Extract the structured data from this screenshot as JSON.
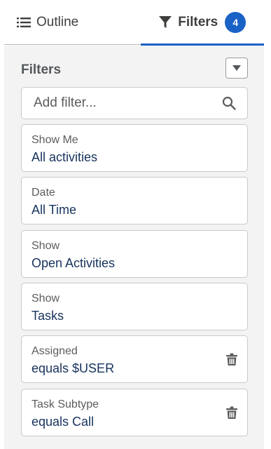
{
  "tabs": {
    "outline_label": "Outline",
    "filters_label": "Filters",
    "filters_count": "4"
  },
  "panel": {
    "title": "Filters",
    "search_placeholder": "Add filter..."
  },
  "filters": [
    {
      "label": "Show Me",
      "value": "All activities",
      "removable": false
    },
    {
      "label": "Date",
      "value": "All Time",
      "removable": false
    },
    {
      "label": "Show",
      "value": "Open Activities",
      "removable": false
    },
    {
      "label": "Show",
      "value": "Tasks",
      "removable": false
    },
    {
      "label": "Assigned",
      "value": "equals $USER",
      "removable": true
    },
    {
      "label": "Task Subtype",
      "value": "equals Call",
      "removable": true
    }
  ],
  "colors": {
    "accent": "#1b62c6",
    "value_text": "#16325c",
    "panel_bg": "#f3f3f3"
  },
  "icons": {
    "outline": "list-icon",
    "filters": "funnel-icon",
    "collapse": "caret-down-icon",
    "search": "search-icon",
    "remove": "trash-icon"
  }
}
